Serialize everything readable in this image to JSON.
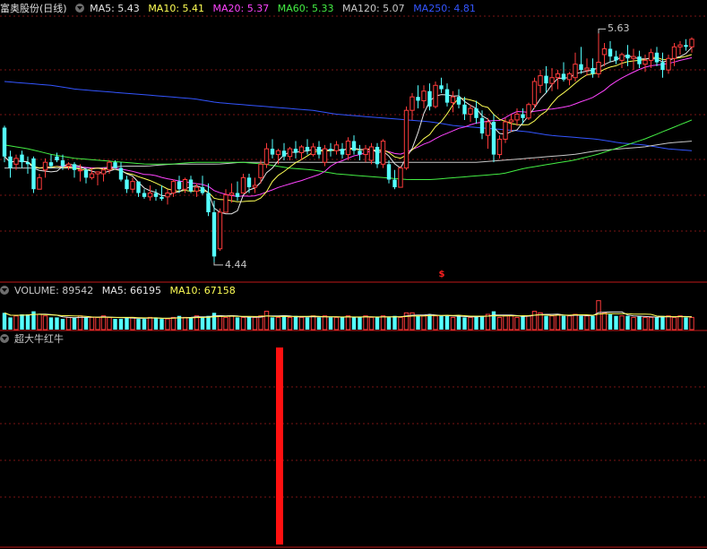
{
  "colors": {
    "up": "#ff3b3b",
    "down": "#54ffff",
    "ma5": "#e6e6e6",
    "ma10": "#ffff55",
    "ma20": "#ff44ff",
    "ma60": "#44ee44",
    "ma120": "#c8c8c8",
    "ma250": "#3355ff",
    "grid": "#7a1515",
    "separator": "#c01818",
    "signal": "#ff1010"
  },
  "main_panel": {
    "title": "富奥股份(日线)",
    "ma5": "MA5: 5.43",
    "ma10": "MA10: 5.41",
    "ma20": "MA20: 5.37",
    "ma60": "MA60: 5.33",
    "ma120": "MA120: 5.07",
    "ma250": "MA250: 4.81",
    "high_mark": "5.63",
    "low_mark": "4.44",
    "signal_glyph": "$"
  },
  "volume_panel": {
    "volume": "VOLUME: 89542",
    "ma5": "MA5: 66195",
    "ma10": "MA10: 67158"
  },
  "indicator_panel": {
    "title": "超大牛红牛"
  },
  "chart_data": {
    "type": "candlestick",
    "ohlc": [
      [
        5.14,
        5.15,
        4.96,
        4.99
      ],
      [
        4.99,
        5.02,
        4.88,
        4.93
      ],
      [
        4.95,
        5.0,
        4.92,
        4.98
      ],
      [
        5.0,
        5.02,
        4.93,
        4.96
      ],
      [
        4.96,
        4.99,
        4.9,
        4.95
      ],
      [
        4.98,
        4.99,
        4.8,
        4.82
      ],
      [
        4.82,
        4.9,
        4.82,
        4.88
      ],
      [
        4.92,
        4.98,
        4.88,
        4.96
      ],
      [
        4.96,
        5.0,
        4.93,
        4.94
      ],
      [
        4.99,
        5.01,
        4.96,
        4.97
      ],
      [
        4.97,
        5.0,
        4.92,
        4.94
      ],
      [
        4.94,
        4.96,
        4.92,
        4.95
      ],
      [
        4.95,
        4.96,
        4.88,
        4.92
      ],
      [
        4.92,
        4.95,
        4.86,
        4.92
      ],
      [
        4.92,
        4.93,
        4.85,
        4.88
      ],
      [
        4.88,
        4.93,
        4.87,
        4.9
      ],
      [
        4.9,
        4.91,
        4.84,
        4.91
      ],
      [
        4.9,
        4.93,
        4.86,
        4.92
      ],
      [
        4.92,
        4.97,
        4.9,
        4.96
      ],
      [
        4.96,
        4.97,
        4.93,
        4.93
      ],
      [
        4.93,
        4.96,
        4.86,
        4.87
      ],
      [
        4.87,
        4.89,
        4.8,
        4.82
      ],
      [
        4.82,
        4.88,
        4.8,
        4.86
      ],
      [
        4.86,
        4.86,
        4.78,
        4.8
      ],
      [
        4.8,
        4.82,
        4.77,
        4.78
      ],
      [
        4.78,
        4.84,
        4.76,
        4.8
      ],
      [
        4.8,
        4.82,
        4.76,
        4.78
      ],
      [
        4.78,
        4.84,
        4.76,
        4.77
      ],
      [
        4.78,
        4.82,
        4.74,
        4.8
      ],
      [
        4.8,
        4.87,
        4.78,
        4.86
      ],
      [
        4.86,
        4.89,
        4.8,
        4.82
      ],
      [
        4.82,
        4.88,
        4.8,
        4.87
      ],
      [
        4.87,
        4.89,
        4.8,
        4.81
      ],
      [
        4.81,
        4.85,
        4.78,
        4.83
      ],
      [
        4.83,
        4.89,
        4.79,
        4.8
      ],
      [
        4.8,
        4.85,
        4.68,
        4.7
      ],
      [
        4.7,
        4.76,
        4.44,
        4.47
      ],
      [
        4.51,
        4.72,
        4.5,
        4.7
      ],
      [
        4.7,
        4.82,
        4.7,
        4.79
      ],
      [
        4.79,
        4.85,
        4.75,
        4.8
      ],
      [
        4.8,
        4.86,
        4.76,
        4.78
      ],
      [
        4.8,
        4.9,
        4.8,
        4.88
      ],
      [
        4.88,
        4.9,
        4.8,
        4.83
      ],
      [
        4.83,
        4.88,
        4.8,
        4.84
      ],
      [
        4.88,
        4.97,
        4.85,
        4.95
      ],
      [
        4.95,
        5.06,
        4.93,
        5.03
      ],
      [
        5.03,
        5.08,
        4.98,
        5.0
      ],
      [
        5.0,
        5.03,
        4.95,
        5.02
      ],
      [
        5.02,
        5.06,
        4.97,
        4.99
      ],
      [
        4.99,
        5.04,
        4.97,
        5.03
      ],
      [
        5.03,
        5.07,
        4.98,
        5.01
      ],
      [
        5.01,
        5.05,
        4.97,
        5.04
      ],
      [
        5.04,
        5.08,
        5.0,
        5.02
      ],
      [
        5.0,
        5.06,
        4.99,
        5.04
      ],
      [
        5.04,
        5.07,
        4.98,
        5.0
      ],
      [
        4.96,
        5.05,
        4.94,
        5.03
      ],
      [
        5.03,
        5.06,
        4.99,
        5.02
      ],
      [
        5.02,
        5.07,
        5.0,
        5.05
      ],
      [
        5.03,
        5.06,
        4.98,
        5.0
      ],
      [
        5.0,
        5.09,
        4.97,
        5.07
      ],
      [
        5.07,
        5.1,
        5.0,
        5.02
      ],
      [
        5.02,
        5.05,
        4.97,
        5.0
      ],
      [
        5.0,
        5.05,
        4.96,
        5.03
      ],
      [
        4.97,
        5.06,
        4.95,
        5.04
      ],
      [
        5.04,
        5.06,
        4.93,
        4.95
      ],
      [
        4.95,
        5.08,
        4.93,
        5.07
      ],
      [
        4.95,
        4.97,
        4.85,
        4.87
      ],
      [
        4.87,
        4.92,
        4.82,
        4.83
      ],
      [
        4.83,
        4.94,
        4.83,
        4.93
      ],
      [
        4.93,
        5.25,
        4.92,
        5.23
      ],
      [
        5.23,
        5.32,
        5.18,
        5.3
      ],
      [
        5.3,
        5.36,
        5.24,
        5.28
      ],
      [
        5.28,
        5.36,
        5.24,
        5.33
      ],
      [
        5.33,
        5.37,
        5.23,
        5.25
      ],
      [
        5.25,
        5.38,
        5.24,
        5.36
      ],
      [
        5.36,
        5.4,
        5.32,
        5.34
      ],
      [
        5.34,
        5.37,
        5.25,
        5.27
      ],
      [
        5.27,
        5.33,
        5.22,
        5.3
      ],
      [
        5.3,
        5.34,
        5.24,
        5.26
      ],
      [
        5.26,
        5.3,
        5.18,
        5.21
      ],
      [
        5.21,
        5.26,
        5.17,
        5.24
      ],
      [
        5.24,
        5.28,
        5.16,
        5.19
      ],
      [
        5.19,
        5.23,
        5.08,
        5.11
      ],
      [
        5.1,
        5.19,
        5.03,
        5.17
      ],
      [
        5.17,
        5.21,
        4.96,
        5.0
      ],
      [
        5.0,
        5.1,
        4.98,
        5.08
      ],
      [
        5.08,
        5.19,
        5.06,
        5.17
      ],
      [
        5.17,
        5.21,
        5.12,
        5.18
      ],
      [
        5.18,
        5.24,
        5.15,
        5.21
      ],
      [
        5.21,
        5.24,
        5.16,
        5.19
      ],
      [
        5.19,
        5.27,
        5.18,
        5.26
      ],
      [
        5.26,
        5.4,
        5.24,
        5.38
      ],
      [
        5.36,
        5.44,
        5.32,
        5.41
      ],
      [
        5.41,
        5.46,
        5.32,
        5.37
      ],
      [
        5.37,
        5.45,
        5.33,
        5.4
      ],
      [
        5.4,
        5.44,
        5.34,
        5.42
      ],
      [
        5.42,
        5.48,
        5.38,
        5.39
      ],
      [
        5.39,
        5.43,
        5.36,
        5.42
      ],
      [
        5.4,
        5.53,
        5.38,
        5.47
      ],
      [
        5.47,
        5.56,
        5.42,
        5.44
      ],
      [
        5.44,
        5.5,
        5.41,
        5.45
      ],
      [
        5.45,
        5.5,
        5.4,
        5.42
      ],
      [
        5.42,
        5.63,
        5.4,
        5.48
      ],
      [
        5.52,
        5.58,
        5.46,
        5.55
      ],
      [
        5.55,
        5.59,
        5.48,
        5.51
      ],
      [
        5.51,
        5.54,
        5.47,
        5.49
      ],
      [
        5.49,
        5.53,
        5.45,
        5.52
      ],
      [
        5.52,
        5.57,
        5.46,
        5.5
      ],
      [
        5.5,
        5.55,
        5.44,
        5.51
      ],
      [
        5.51,
        5.54,
        5.45,
        5.47
      ],
      [
        5.47,
        5.52,
        5.43,
        5.49
      ],
      [
        5.49,
        5.55,
        5.45,
        5.53
      ],
      [
        5.53,
        5.56,
        5.46,
        5.48
      ],
      [
        5.48,
        5.53,
        5.4,
        5.44
      ],
      [
        5.44,
        5.52,
        5.42,
        5.5
      ],
      [
        5.5,
        5.58,
        5.46,
        5.56
      ],
      [
        5.56,
        5.59,
        5.52,
        5.57
      ],
      [
        5.57,
        5.6,
        5.54,
        5.56
      ],
      [
        5.56,
        5.61,
        5.53,
        5.6
      ]
    ],
    "volume_ratio": [
      0.55,
      0.4,
      0.45,
      0.5,
      0.5,
      0.6,
      0.5,
      0.45,
      0.4,
      0.4,
      0.35,
      0.4,
      0.4,
      0.45,
      0.4,
      0.4,
      0.4,
      0.45,
      0.4,
      0.35,
      0.35,
      0.4,
      0.4,
      0.35,
      0.35,
      0.4,
      0.4,
      0.35,
      0.35,
      0.4,
      0.45,
      0.4,
      0.4,
      0.45,
      0.4,
      0.45,
      0.55,
      0.45,
      0.4,
      0.45,
      0.4,
      0.4,
      0.4,
      0.4,
      0.45,
      0.6,
      0.4,
      0.4,
      0.45,
      0.4,
      0.45,
      0.4,
      0.4,
      0.45,
      0.4,
      0.45,
      0.4,
      0.4,
      0.4,
      0.45,
      0.4,
      0.4,
      0.45,
      0.4,
      0.4,
      0.45,
      0.4,
      0.45,
      0.4,
      0.55,
      0.55,
      0.45,
      0.45,
      0.5,
      0.45,
      0.45,
      0.45,
      0.4,
      0.45,
      0.4,
      0.4,
      0.45,
      0.45,
      0.5,
      0.6,
      0.4,
      0.45,
      0.45,
      0.4,
      0.45,
      0.45,
      0.6,
      0.55,
      0.45,
      0.45,
      0.5,
      0.45,
      0.45,
      0.5,
      0.45,
      0.45,
      0.45,
      0.95,
      0.55,
      0.5,
      0.45,
      0.45,
      0.45,
      0.4,
      0.45,
      0.4,
      0.4,
      0.4,
      0.45,
      0.45,
      0.4,
      0.45,
      0.4,
      0.4
    ],
    "ma60": [
      5.05,
      5.03,
      5.0,
      4.98,
      4.97,
      4.96,
      4.95,
      4.95,
      4.96,
      4.96,
      4.96,
      4.95,
      4.93,
      4.92,
      4.9,
      4.89,
      4.88,
      4.87,
      4.87,
      4.88,
      4.89,
      4.9,
      4.93,
      4.95,
      4.97,
      5.0,
      5.04,
      5.08,
      5.13,
      5.18
    ],
    "ma120": [
      4.93,
      4.93,
      4.93,
      4.93,
      4.93,
      4.94,
      4.94,
      4.95,
      4.95,
      4.95,
      4.96,
      4.96,
      4.96,
      4.96,
      4.96,
      4.96,
      4.96,
      4.96,
      4.96,
      4.96,
      4.96,
      4.97,
      4.98,
      4.99,
      5.0,
      5.02,
      5.03,
      5.04,
      5.06,
      5.07
    ],
    "ma250": [
      5.38,
      5.37,
      5.36,
      5.34,
      5.33,
      5.32,
      5.31,
      5.3,
      5.29,
      5.27,
      5.26,
      5.25,
      5.24,
      5.23,
      5.21,
      5.2,
      5.19,
      5.18,
      5.17,
      5.15,
      5.14,
      5.13,
      5.12,
      5.1,
      5.09,
      5.08,
      5.06,
      5.05,
      5.03,
      5.02
    ],
    "signal_index": 75
  }
}
